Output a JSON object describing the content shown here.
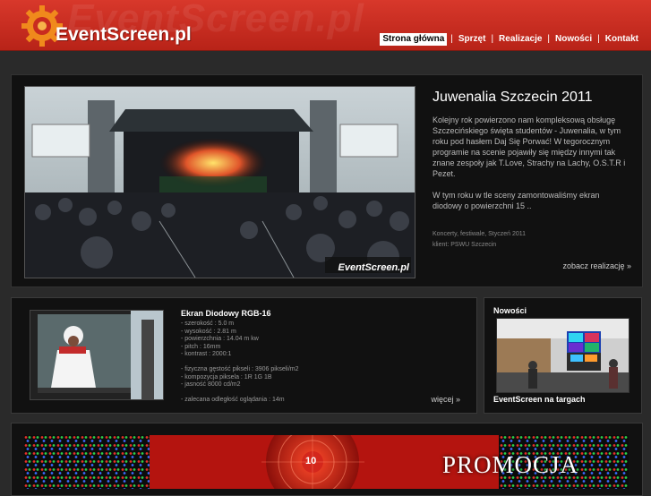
{
  "header": {
    "logo_text": "EventScreen.pl",
    "watermark_text": "EventScreen.pl",
    "nav": [
      {
        "label": "Strona główna",
        "active": true
      },
      {
        "label": "Sprzęt",
        "active": false
      },
      {
        "label": "Realizacje",
        "active": false
      },
      {
        "label": "Nowości",
        "active": false
      },
      {
        "label": "Kontakt",
        "active": false
      }
    ],
    "nav_separator": "|"
  },
  "featured": {
    "photo_watermark": "EventScreen.pl",
    "title": "Juwenalia Szczecin 2011",
    "paragraph_1": "Kolejny rok powierzono nam kompleksową obsługę Szczecińskiego święta studentów - Juwenalia, w tym roku pod hasłem Daj Się Porwać! W tegorocznym programie na scenie pojawiły się między innymi tak znane zespoły jak T.Love, Strachy na Lachy, O.S.T.R i Pezet.",
    "paragraph_2": "W tym roku w tle sceny zamontowaliśmy ekran diodowy o powierzchni 15 ..",
    "meta_category": "Koncerty, festiwale, Styczeń 2011",
    "meta_client": "klient: PSWU Szczecin",
    "more_link": "zobacz realizację »"
  },
  "product": {
    "title": "Ekran Diodowy RGB-16",
    "specs": [
      "- szerokość : 5.0 m",
      "- wysokość : 2.81 m",
      "- powierzchnia : 14.04 m kw",
      "- pitch : 16mm",
      "- kontrast : 2000:1",
      "",
      "- fizyczna gęstość pikseli : 3906 pikseli/m2",
      "- kompozycja piksela : 1R 1G 1B",
      "- jasność 8000 cd/m2",
      "",
      "- zalecana odległość oglądania : 14m"
    ],
    "more_link": "więcej »"
  },
  "news": {
    "heading": "Nowości",
    "caption": "EventScreen na targach"
  },
  "promo": {
    "text": "PROMOCJA",
    "badge": "10"
  },
  "colors": {
    "header_red": "#c92b1f",
    "background": "#2a2a2a",
    "panel": "#111111"
  }
}
